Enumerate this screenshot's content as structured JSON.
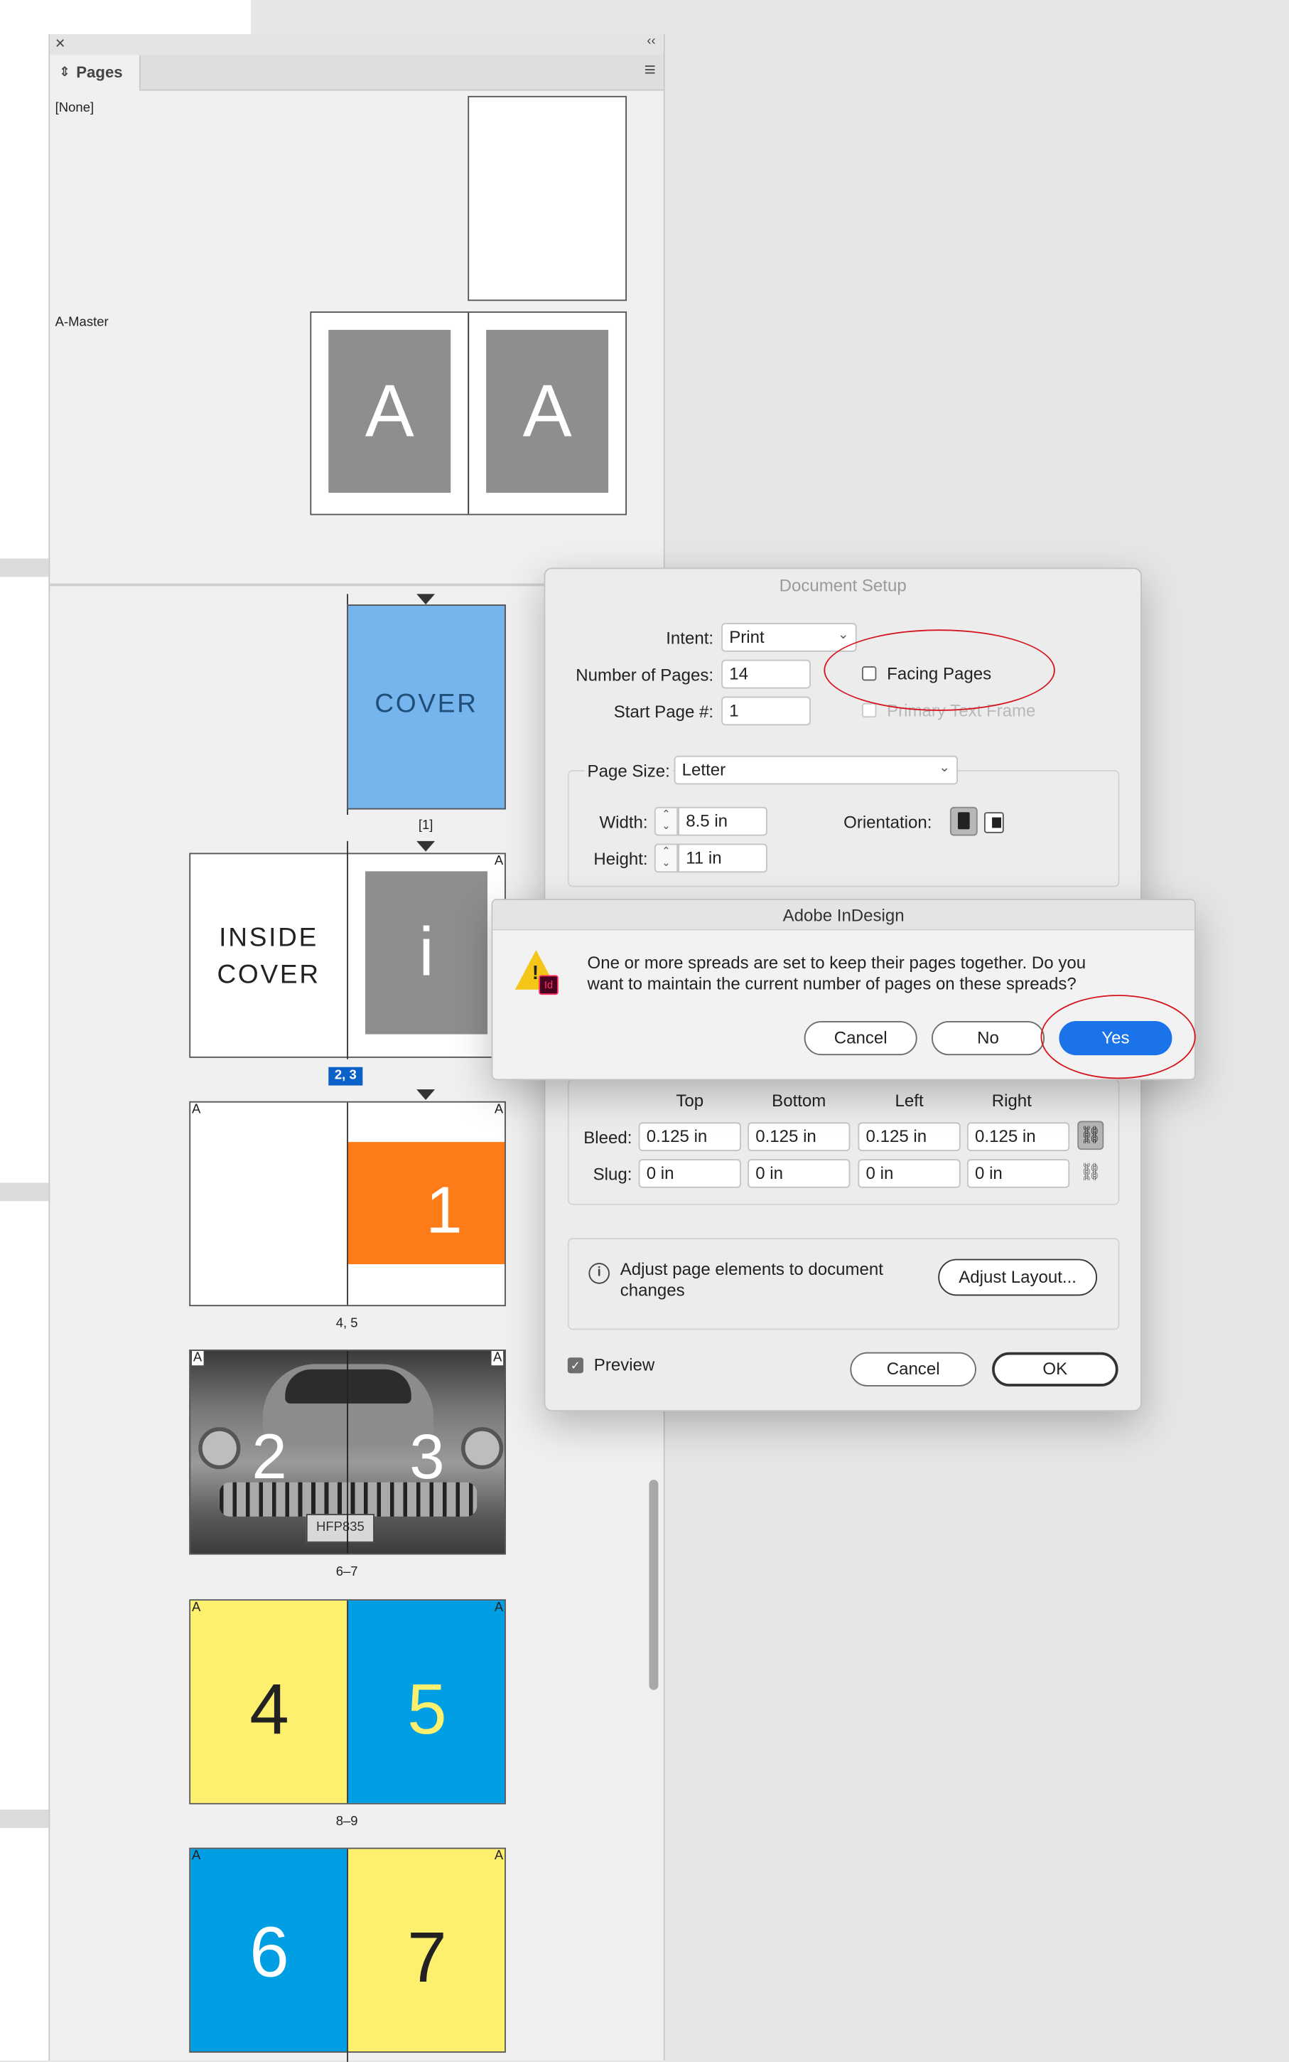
{
  "pages_panel": {
    "close_glyph": "×",
    "collapse_glyph": "‹‹",
    "tab_arrow": "⇕",
    "tab_label": "Pages",
    "menu_glyph": "≡",
    "masters": [
      {
        "label": "[None]"
      },
      {
        "label": "A-Master",
        "letter_left": "A",
        "letter_right": "A"
      }
    ],
    "spreads": [
      {
        "cover_text": "COVER",
        "label": "[1]"
      },
      {
        "inside_line1": "INSIDE",
        "inside_line2": "COVER",
        "right_letter": "i",
        "label": "2, 3",
        "corner": "A"
      },
      {
        "right_number": "1",
        "label": "4, 5",
        "corner_left": "A",
        "corner_right": "A"
      },
      {
        "left_number": "2",
        "right_number": "3",
        "label": "6–7",
        "plate": "HFP835",
        "corner_left": "A",
        "corner_right": "A"
      },
      {
        "left_number": "4",
        "right_number": "5",
        "label": "8–9",
        "corner_left": "A",
        "corner_right": "A"
      },
      {
        "left_number": "6",
        "right_number": "7",
        "corner_left": "A",
        "corner_right": "A"
      }
    ]
  },
  "document_setup": {
    "title": "Document Setup",
    "intent_label": "Intent:",
    "intent_value": "Print",
    "num_pages_label": "Number of Pages:",
    "num_pages_value": "14",
    "start_page_label": "Start Page #:",
    "start_page_value": "1",
    "facing_pages_label": "Facing Pages",
    "primary_text_frame_label": "Primary Text Frame",
    "page_size_label": "Page Size:",
    "page_size_value": "Letter",
    "width_label": "Width:",
    "width_value": "8.5 in",
    "height_label": "Height:",
    "height_value": "11 in",
    "orientation_label": "Orientation:",
    "col_top": "Top",
    "col_bottom": "Bottom",
    "col_left": "Left",
    "col_right": "Right",
    "bleed_label": "Bleed:",
    "bleed_values": [
      "0.125 in",
      "0.125 in",
      "0.125 in",
      "0.125 in"
    ],
    "slug_label": "Slug:",
    "slug_values": [
      "0 in",
      "0 in",
      "0 in",
      "0 in"
    ],
    "adjust_text_line1": "Adjust page elements to document",
    "adjust_text_line2": "changes",
    "adjust_layout_button": "Adjust Layout...",
    "preview_label": "Preview",
    "cancel_button": "Cancel",
    "ok_button": "OK"
  },
  "alert": {
    "title": "Adobe InDesign",
    "icon_badge": "Id",
    "message_line1": "One or more spreads are set to keep their pages together. Do you",
    "message_line2": "want to maintain the current number of pages on these spreads?",
    "cancel_button": "Cancel",
    "no_button": "No",
    "yes_button": "Yes"
  },
  "colors": {
    "cover_blue": "#75b4ec",
    "cover_text": "#1f4e79",
    "orange": "#fe7c17",
    "yellow": "#fcf06e",
    "cyan": "#009ee3",
    "master_gray": "#8e8e8e",
    "alert_blue": "#1a73e8",
    "annotation_red": "#d6141e"
  }
}
